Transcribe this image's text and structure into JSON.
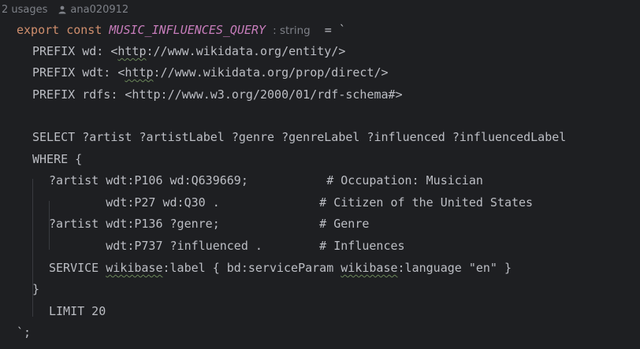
{
  "meta": {
    "usages": "2 usages",
    "author": "ana020912",
    "author_icon": "person-icon"
  },
  "code": {
    "decl_export": "export",
    "decl_const": "const",
    "decl_name": "MUSIC_INFLUENCES_QUERY",
    "decl_type_hint": ": string",
    "decl_assign": "= `",
    "prefix1_a": "PREFIX wd: <",
    "prefix1_http": "http",
    "prefix1_b": "://www.wikidata.org/entity/>",
    "prefix2_a": "PREFIX wdt: <",
    "prefix2_http": "http",
    "prefix2_b": "://www.wikidata.org/prop/direct/>",
    "prefix3": "PREFIX rdfs: <http://www.w3.org/2000/01/rdf-schema#>",
    "select": "SELECT ?artist ?artistLabel ?genre ?genreLabel ?influenced ?influencedLabel",
    "where_open": "WHERE {",
    "t1": "?artist wdt:P106 wd:Q639669;           # Occupation: Musician",
    "t2": "        wdt:P27 wd:Q30 .              # Citizen of the United States",
    "t3": "?artist wdt:P136 ?genre;              # Genre",
    "t4": "        wdt:P737 ?influenced .        # Influences",
    "svc_a": "SERVICE ",
    "svc_wb1": "wikibase",
    "svc_b": ":label { bd:serviceParam ",
    "svc_wb2": "wikibase",
    "svc_c": ":language \"en\" }",
    "where_close": "}",
    "limit": "LIMIT 20",
    "end": "`;"
  }
}
